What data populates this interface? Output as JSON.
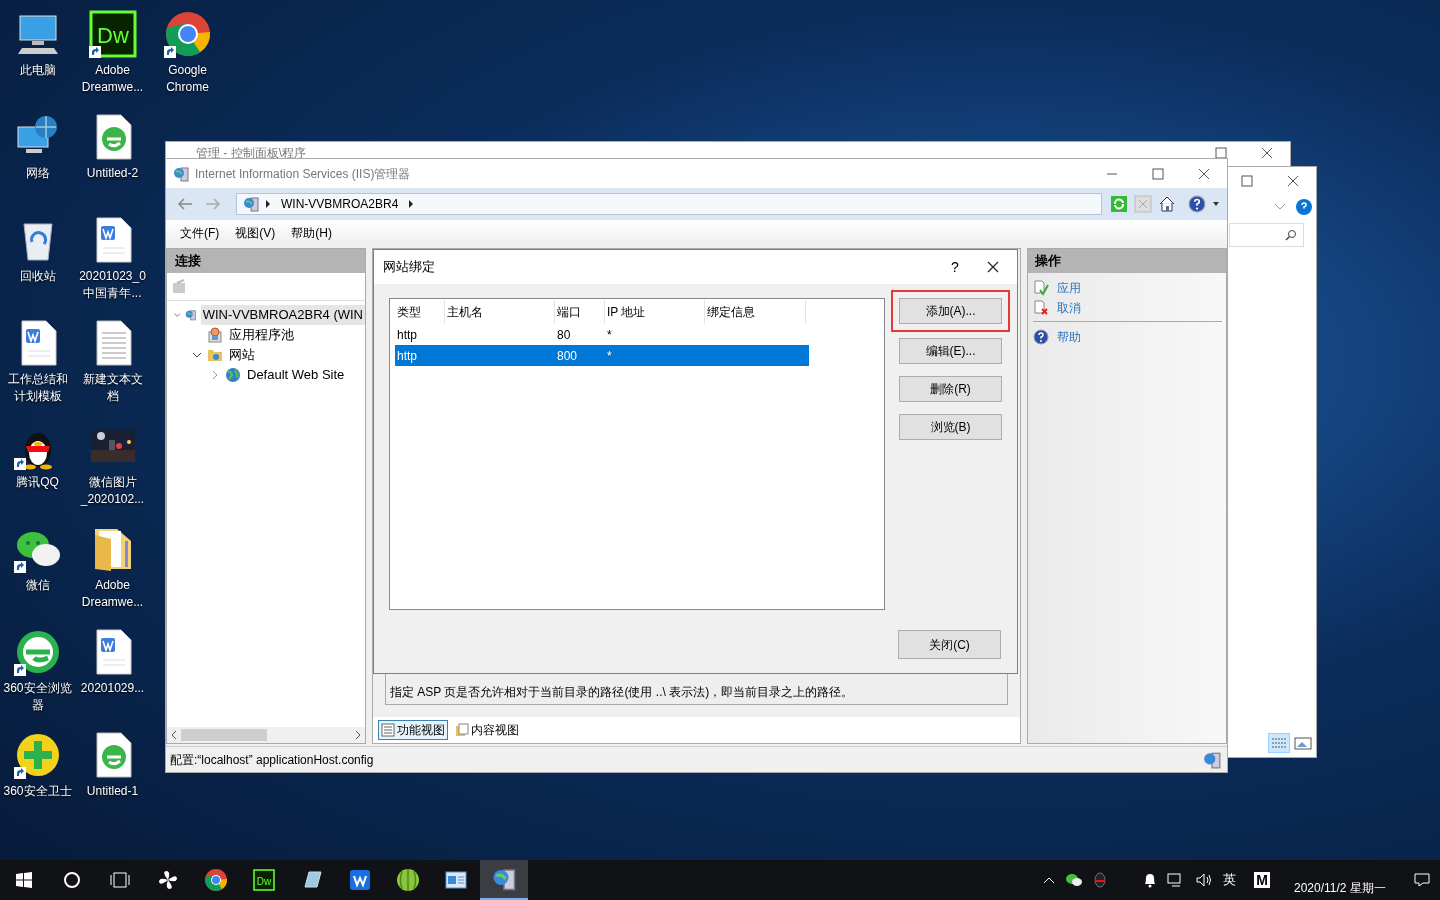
{
  "desktop_icons": [
    {
      "label": "此电脑",
      "kind": "pc",
      "shortcut": false
    },
    {
      "label": "网络",
      "kind": "network",
      "shortcut": false
    },
    {
      "label": "回收站",
      "kind": "recycle",
      "shortcut": false
    },
    {
      "label": "工作总结和计划模板",
      "kind": "word",
      "shortcut": false
    },
    {
      "label": "腾讯QQ",
      "kind": "qq",
      "shortcut": true
    },
    {
      "label": "微信",
      "kind": "wechat",
      "shortcut": true
    },
    {
      "label": "360安全浏览器",
      "kind": "browser360",
      "shortcut": true
    },
    {
      "label": "360安全卫士",
      "kind": "guard360",
      "shortcut": true
    },
    {
      "label": "Adobe\nDreamwe...",
      "kind": "dw",
      "glyph": "Dw",
      "shortcut": true
    },
    {
      "label": "Untitled-2",
      "kind": "iedoc",
      "shortcut": false
    },
    {
      "label": "20201023_0\n中国青年...",
      "kind": "word",
      "shortcut": false
    },
    {
      "label": "新建文本文档",
      "kind": "text",
      "shortcut": false
    },
    {
      "label": "微信图片\n_2020102...",
      "shortcut": false
    },
    {
      "label": "Adobe\nDreamwe...",
      "kind": "folder",
      "shortcut": false
    },
    {
      "label": "20201029...",
      "kind": "word",
      "shortcut": false
    },
    {
      "label": "Untitled-1",
      "kind": "iedoc",
      "shortcut": false
    },
    {
      "label": "Google\nChrome",
      "kind": "chrome",
      "shortcut": true
    }
  ],
  "back_window": {
    "title": "管理 - 控制面板\\程序"
  },
  "iis": {
    "title": "Internet Information Services (IIS)管理器",
    "address": [
      "WIN-VVBMROA2BR4"
    ],
    "menu": [
      "文件(F)",
      "视图(V)",
      "帮助(H)"
    ],
    "connections": {
      "title": "连接",
      "tree": [
        {
          "label": "WIN-VVBMROA2BR4 (WIN",
          "kind": "server",
          "expanded": true,
          "selected": true,
          "children": [
            {
              "label": "应用程序池",
              "kind": "pool",
              "selected": false
            },
            {
              "label": "网站",
              "kind": "sites",
              "expanded": true,
              "selected": false,
              "children": [
                {
                  "label": "Default Web Site",
                  "kind": "site",
                  "expanded": false,
                  "selected": false
                }
              ]
            }
          ]
        }
      ]
    },
    "description": "指定 ASP 页是否允许相对于当前目录的路径(使用 ..\\ 表示法)，即当前目录之上的路径。",
    "view_tabs": [
      {
        "label": "功能视图",
        "kind": "features",
        "selected": true
      },
      {
        "label": "内容视图",
        "kind": "content",
        "selected": false
      }
    ],
    "actions": {
      "title": "操作",
      "items": [
        {
          "label": "应用",
          "kind": "apply"
        },
        {
          "label": "取消",
          "kind": "cancel"
        },
        {
          "label": "帮助",
          "kind": "help"
        }
      ]
    },
    "status": "配置:“localhost” applicationHost.config"
  },
  "dialog": {
    "title": "网站绑定",
    "help": "?",
    "columns": [
      "类型",
      "主机名",
      "端口",
      "IP 地址",
      "绑定信息"
    ],
    "rows": [
      {
        "type": "http",
        "port": "80",
        "ip": "*",
        "selected": false
      },
      {
        "type": "http",
        "port": "800",
        "ip": "*",
        "selected": true
      }
    ],
    "buttons": [
      {
        "label": "添加(A)...",
        "highlighted": true
      },
      {
        "label": "编辑(E)...",
        "highlighted": false
      },
      {
        "label": "删除(R)",
        "highlighted": false
      },
      {
        "label": "浏览(B)",
        "highlighted": false
      }
    ],
    "close_button": "关闭(C)"
  },
  "taskbar": {
    "items": [
      {
        "kind": "start",
        "selected": false
      },
      {
        "kind": "search",
        "selected": false
      },
      {
        "kind": "taskview",
        "selected": false
      },
      {
        "kind": "fan",
        "selected": false
      },
      {
        "kind": "chrome",
        "selected": false
      },
      {
        "kind": "dw",
        "glyph": "Dw",
        "selected": false
      },
      {
        "kind": "notepad",
        "selected": false
      },
      {
        "kind": "wps",
        "selected": false
      },
      {
        "kind": "melon",
        "selected": false
      },
      {
        "kind": "console",
        "selected": false
      },
      {
        "kind": "iis",
        "selected": true
      }
    ],
    "ime": "英",
    "ime_mode": "M",
    "date": "2020/11/2 星期一"
  }
}
